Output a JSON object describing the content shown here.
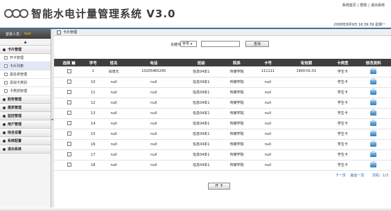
{
  "header": {
    "title": "智能水电计量管理系统 V3.0",
    "links": [
      "系统首页",
      "帮助",
      "退出系统"
    ],
    "separator": "|",
    "datetime": "2008年8月9日 16:39:39 星期一"
  },
  "sidebar": {
    "user_label": "登录人员：",
    "user_name": "test",
    "collapse": "▲",
    "menus": [
      {
        "label": "卡片管理",
        "subs": [
          {
            "label": "开卡管理"
          },
          {
            "label": "卡片列表"
          },
          {
            "label": "黑名单管理"
          },
          {
            "label": "添加卡类别"
          },
          {
            "label": "卡类别管理"
          }
        ]
      },
      {
        "label": "财务管理"
      },
      {
        "label": "报表管理"
      },
      {
        "label": "监控管理"
      },
      {
        "label": "用户管理"
      },
      {
        "label": "综合设置"
      },
      {
        "label": "系统配置"
      },
      {
        "label": "退出系统"
      }
    ]
  },
  "main": {
    "title": "卡片管理",
    "search": {
      "label": "关键字",
      "select_value": "学号",
      "button": "查询"
    },
    "columns": [
      "选择",
      "学号",
      "姓名",
      "电话",
      "班级",
      "院系",
      "卡号",
      "有效期",
      "卡类型",
      "修改资料"
    ],
    "rows": [
      {
        "no": "1",
        "name": "肖增元",
        "phone": "13205465245",
        "class": "信息04本1",
        "dept": "传媒学院",
        "card": "111111",
        "valid": "1900-01-01",
        "type": "学生卡"
      },
      {
        "no": "10",
        "name": "null",
        "phone": "null",
        "class": "信息04本1",
        "dept": "传媒学院",
        "card": "null",
        "valid": "",
        "type": "学生卡"
      },
      {
        "no": "11",
        "name": "null",
        "phone": "null",
        "class": "信息04本1",
        "dept": "传媒学院",
        "card": "null",
        "valid": "",
        "type": "学生卡"
      },
      {
        "no": "12",
        "name": "null",
        "phone": "null",
        "class": "信息04本1",
        "dept": "传媒学院",
        "card": "null",
        "valid": "",
        "type": "学生卡"
      },
      {
        "no": "13",
        "name": "null",
        "phone": "null",
        "class": "信息04本1",
        "dept": "传媒学院",
        "card": "null",
        "valid": "",
        "type": "学生卡"
      },
      {
        "no": "14",
        "name": "null",
        "phone": "null",
        "class": "信息04本1",
        "dept": "传媒学院",
        "card": "null",
        "valid": "",
        "type": "学生卡"
      },
      {
        "no": "15",
        "name": "null",
        "phone": "null",
        "class": "信息04本1",
        "dept": "传媒学院",
        "card": "null",
        "valid": "",
        "type": "学生卡"
      },
      {
        "no": "16",
        "name": "null",
        "phone": "null",
        "class": "信息04本1",
        "dept": "传媒学院",
        "card": "null",
        "valid": "",
        "type": "学生卡"
      },
      {
        "no": "17",
        "name": "null",
        "phone": "null",
        "class": "信息04本1",
        "dept": "传媒学院",
        "card": "null",
        "valid": "",
        "type": "学生卡"
      },
      {
        "no": "18",
        "name": "null",
        "phone": "null",
        "class": "信息04本1",
        "dept": "传媒学院",
        "card": "null",
        "valid": "",
        "type": "学生卡"
      }
    ],
    "pager": {
      "next": "下一页",
      "last": "最后一页",
      "page_label": "页码：",
      "page_value": "1/3"
    },
    "open_button": "开 卡"
  }
}
